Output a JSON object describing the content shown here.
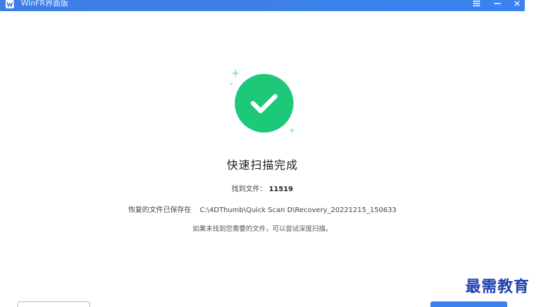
{
  "window": {
    "title": "WinFR界面版",
    "menu_icon": "hamburger-icon",
    "minimize_icon": "minimize-icon",
    "close_icon": "close-icon",
    "titlebar_color": "#3b82f0"
  },
  "result": {
    "status_icon": "check-circle-icon",
    "status_color": "#1ec879",
    "headline": "快速扫描完成",
    "found_label": "找到文件：",
    "found_count": "11519",
    "saved_label": "恢复的文件已保存在",
    "saved_path": "C:\\4DThumb\\Quick Scan D\\Recovery_20221215_150633",
    "hint": "如果未找到您需要的文件，可以尝试深度扫描。"
  },
  "watermark": {
    "text": "最需教育"
  }
}
